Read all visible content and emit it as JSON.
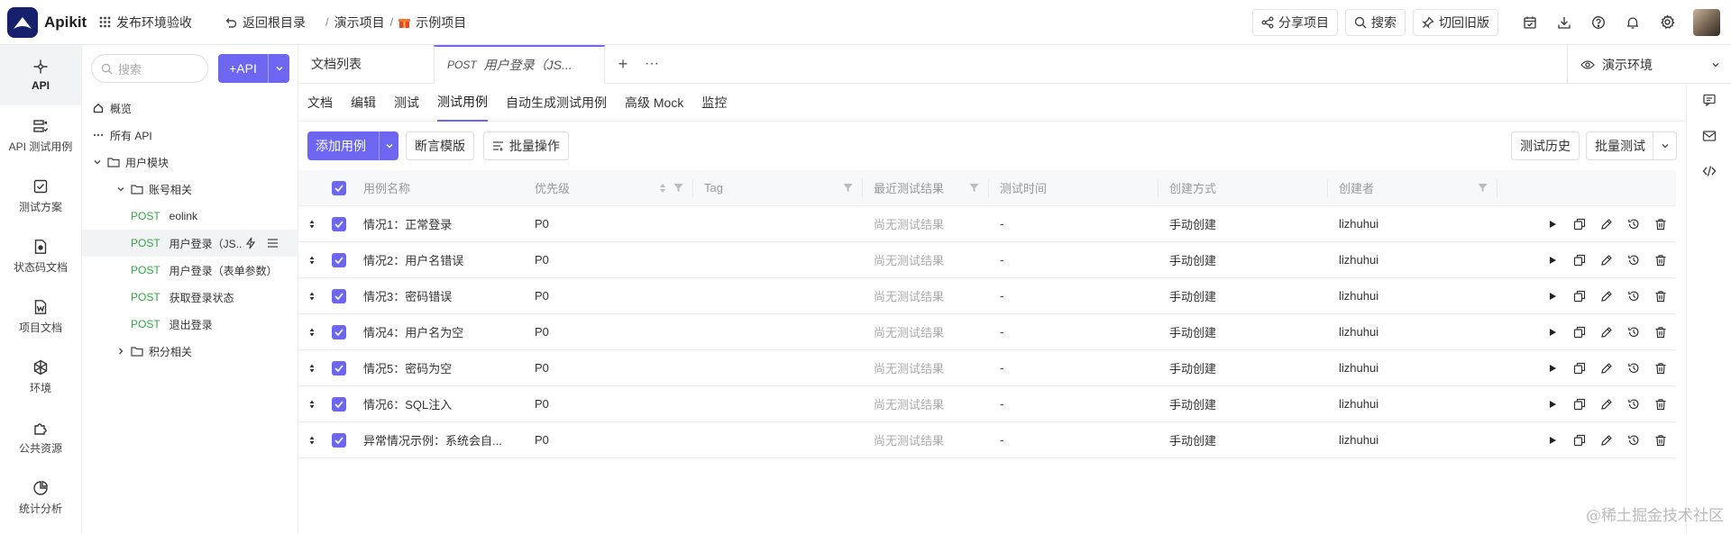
{
  "app": {
    "name": "Apikit",
    "workspace": "发布环境验收"
  },
  "topbar": {
    "back_root": "返回根目录",
    "breadcrumb": [
      "演示项目",
      "示例项目"
    ],
    "share": "分享项目",
    "search": "搜索",
    "old_version": "切回旧版"
  },
  "leftnav": [
    {
      "label": "API",
      "icon": "api-icon"
    },
    {
      "label": "API 测试用例",
      "icon": "test-case-icon"
    },
    {
      "label": "测试方案",
      "icon": "test-plan-icon"
    },
    {
      "label": "状态码文档",
      "icon": "status-code-icon"
    },
    {
      "label": "项目文档",
      "icon": "project-doc-icon"
    },
    {
      "label": "环境",
      "icon": "environment-icon"
    },
    {
      "label": "公共资源",
      "icon": "resource-icon"
    },
    {
      "label": "统计分析",
      "icon": "chart-icon"
    }
  ],
  "tree": {
    "search_placeholder": "搜索",
    "add_label": "+API",
    "overview": "概览",
    "all_api": "所有 API",
    "group_user": "用户模块",
    "group_account": "账号相关",
    "apis": [
      {
        "method": "POST",
        "name": "eolink"
      },
      {
        "method": "POST",
        "name": "用户登录（JS..."
      },
      {
        "method": "POST",
        "name": "用户登录（表单参数）"
      },
      {
        "method": "POST",
        "name": "获取登录状态"
      },
      {
        "method": "POST",
        "name": "退出登录"
      }
    ],
    "group_points": "积分相关"
  },
  "tabs": {
    "doc_list": "文档列表",
    "active_method": "POST",
    "active_title": "用户登录（JS...",
    "env": "演示环境"
  },
  "subtabs": [
    "文档",
    "编辑",
    "测试",
    "测试用例",
    "自动生成测试用例",
    "高级 Mock",
    "监控"
  ],
  "toolbar": {
    "add_case": "添加用例",
    "assert_template": "断言模版",
    "batch_ops": "批量操作",
    "history": "测试历史",
    "batch_test": "批量测试"
  },
  "table": {
    "headers": [
      "用例名称",
      "优先级",
      "Tag",
      "最近测试结果",
      "测试时间",
      "创建方式",
      "创建者"
    ],
    "rows": [
      {
        "name": "情况1：正常登录",
        "priority": "P0",
        "tag": "",
        "result": "尚无测试结果",
        "time": "-",
        "method": "手动创建",
        "creator": "lizhuhui"
      },
      {
        "name": "情况2：用户名错误",
        "priority": "P0",
        "tag": "",
        "result": "尚无测试结果",
        "time": "-",
        "method": "手动创建",
        "creator": "lizhuhui"
      },
      {
        "name": "情况3：密码错误",
        "priority": "P0",
        "tag": "",
        "result": "尚无测试结果",
        "time": "-",
        "method": "手动创建",
        "creator": "lizhuhui"
      },
      {
        "name": "情况4：用户名为空",
        "priority": "P0",
        "tag": "",
        "result": "尚无测试结果",
        "time": "-",
        "method": "手动创建",
        "creator": "lizhuhui"
      },
      {
        "name": "情况5：密码为空",
        "priority": "P0",
        "tag": "",
        "result": "尚无测试结果",
        "time": "-",
        "method": "手动创建",
        "creator": "lizhuhui"
      },
      {
        "name": "情况6：SQL注入",
        "priority": "P0",
        "tag": "",
        "result": "尚无测试结果",
        "time": "-",
        "method": "手动创建",
        "creator": "lizhuhui"
      },
      {
        "name": "异常情况示例：系统会自...",
        "priority": "P0",
        "tag": "",
        "result": "尚无测试结果",
        "time": "-",
        "method": "手动创建",
        "creator": "lizhuhui"
      }
    ]
  },
  "watermark": "@稀土掘金技术社区",
  "colors": {
    "primary": "#6c66f0",
    "post": "#2fa83f",
    "logo_bg": "#16206b"
  }
}
